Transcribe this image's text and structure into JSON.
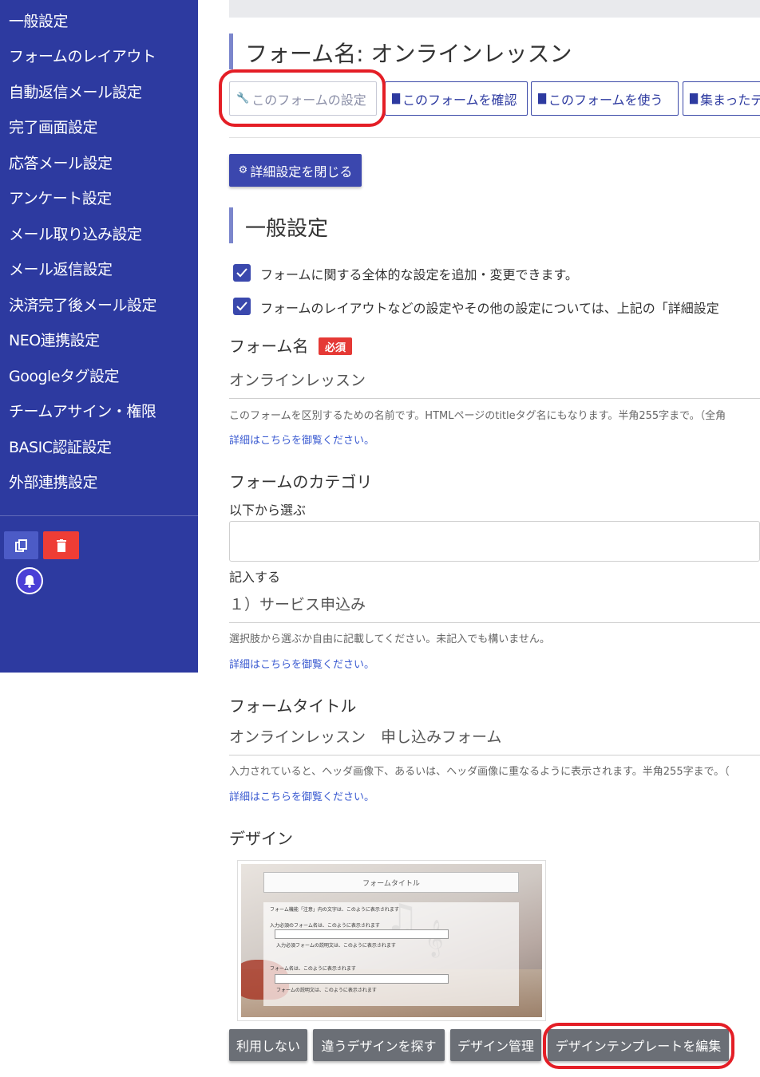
{
  "sidebar": {
    "items": [
      {
        "label": "一般設定"
      },
      {
        "label": "フォームのレイアウト"
      },
      {
        "label": "自動返信メール設定"
      },
      {
        "label": "完了画面設定"
      },
      {
        "label": "応答メール設定"
      },
      {
        "label": "アンケート設定"
      },
      {
        "label": "メール取り込み設定"
      },
      {
        "label": "メール返信設定"
      },
      {
        "label": "決済完了後メール設定"
      },
      {
        "label": "NEO連携設定"
      },
      {
        "label": "Googleタグ設定"
      },
      {
        "label": "チームアサイン・権限"
      },
      {
        "label": "BASIC認証設定"
      },
      {
        "label": "外部連携設定"
      }
    ],
    "actions": {
      "copy_icon": "copy-icon",
      "delete_icon": "trash-icon",
      "bell_icon": "bell-icon"
    }
  },
  "header": {
    "form_title": "フォーム名: オンラインレッスン"
  },
  "toolbar": {
    "buttons": [
      {
        "label": "このフォームの設定",
        "icon": "wrench-icon"
      },
      {
        "label": "このフォームを確認",
        "icon": "document-icon"
      },
      {
        "label": "このフォームを使う",
        "icon": "document-icon"
      },
      {
        "label": "集まったデ",
        "icon": "message-icon"
      }
    ]
  },
  "detail_button": {
    "label": "詳細設定を閉じる",
    "icon": "gear-icon"
  },
  "section": {
    "title": "一般設定",
    "notes": [
      "フォームに関する全体的な設定を追加・変更できます。",
      "フォームのレイアウトなどの設定やその他の設定については、上記の「詳細設定"
    ]
  },
  "fields": {
    "form_name": {
      "label": "フォーム名",
      "required_badge": "必須",
      "value": "オンラインレッスン",
      "help": "このフォームを区別するための名前です。HTMLページのtitleタグ名にもなります。半角255字まで。（全角",
      "link": "詳細はこちらを御覧ください。"
    },
    "category": {
      "label": "フォームのカテゴリ",
      "select_label": "以下から選ぶ",
      "select_value": "",
      "input_label": "記入する",
      "value": "１）サービス申込み",
      "help": "選択肢から選ぶか自由に記載してください。未記入でも構いません。",
      "link": "詳細はこちらを御覧ください。"
    },
    "form_title": {
      "label": "フォームタイトル",
      "value": "オンラインレッスン　申し込みフォーム",
      "help": "入力されていると、ヘッダ画像下、あるいは、ヘッダ画像に重なるように表示されます。半角255字まで。（",
      "link": "詳細はこちらを御覧ください。"
    },
    "design": {
      "label": "デザイン",
      "preview": {
        "title": "フォームタイトル",
        "line1": "フォーム機能「注意」内の文字は、このように表示されます",
        "line2": "入力必須のフォーム名は、このように表示されます",
        "line3": "入力必須フォームの説明文は、このように表示されます",
        "line4": "フォーム名は、このように表示されます",
        "line5": "フォームの説明文は、このように表示されます"
      },
      "buttons": [
        "利用しない",
        "違うデザインを探す",
        "デザイン管理",
        "デザインテンプレートを編集"
      ]
    }
  },
  "colors": {
    "sidebar_bg": "#2d3aa0",
    "primary": "#3b47ae",
    "danger": "#ee3d35",
    "highlight_circle": "#e41e26"
  }
}
